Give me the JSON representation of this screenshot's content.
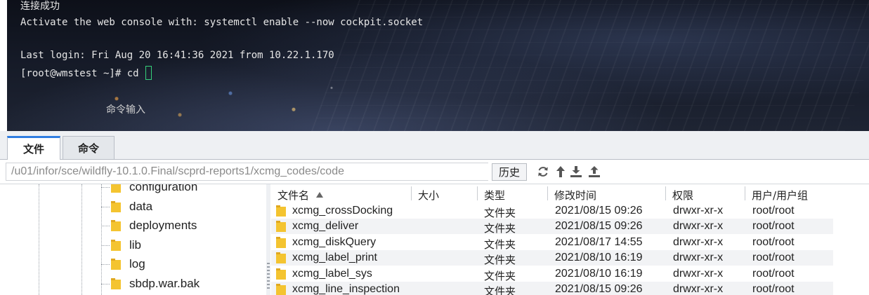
{
  "terminal": {
    "lines": [
      "连接成功",
      "Activate the web console with: systemctl enable --now cockpit.socket",
      "Last login: Fri Aug 20 16:41:36 2021 from 10.22.1.170",
      "[root@wmstest ~]# cd "
    ],
    "command_hint": "命令输入",
    "cursor_color": "#35d07a"
  },
  "tabs": [
    {
      "label": "文件",
      "active": true
    },
    {
      "label": "命令",
      "active": false
    }
  ],
  "toolbar": {
    "path": "/u01/infor/sce/wildfly-10.1.0.Final/scprd-reports1/xcmg_codes/code",
    "history_label": "历史",
    "icons": [
      "refresh-icon",
      "up-arrow-icon",
      "download-icon",
      "upload-icon"
    ]
  },
  "tree": {
    "items": [
      "configuration",
      "data",
      "deployments",
      "lib",
      "log",
      "sbdp.war.bak"
    ]
  },
  "file_list": {
    "columns": [
      "文件名",
      "大小",
      "类型",
      "修改时间",
      "权限",
      "用户/用户组"
    ],
    "rows": [
      {
        "name": "xcmg_crossDocking",
        "size": "",
        "type": "文件夹",
        "modified": "2021/08/15 09:26",
        "perm": "drwxr-xr-x",
        "owner": "root/root"
      },
      {
        "name": "xcmg_deliver",
        "size": "",
        "type": "文件夹",
        "modified": "2021/08/15 09:26",
        "perm": "drwxr-xr-x",
        "owner": "root/root"
      },
      {
        "name": "xcmg_diskQuery",
        "size": "",
        "type": "文件夹",
        "modified": "2021/08/17 14:55",
        "perm": "drwxr-xr-x",
        "owner": "root/root"
      },
      {
        "name": "xcmg_label_print",
        "size": "",
        "type": "文件夹",
        "modified": "2021/08/10 16:19",
        "perm": "drwxr-xr-x",
        "owner": "root/root"
      },
      {
        "name": "xcmg_label_sys",
        "size": "",
        "type": "文件夹",
        "modified": "2021/08/10 16:19",
        "perm": "drwxr-xr-x",
        "owner": "root/root"
      },
      {
        "name": "xcmg_line_inspection",
        "size": "",
        "type": "文件夹",
        "modified": "2021/08/15 09:26",
        "perm": "drwxr-xr-x",
        "owner": "root/root"
      }
    ]
  },
  "colors": {
    "accent": "#2f7de1",
    "folder": "#f4c430"
  }
}
